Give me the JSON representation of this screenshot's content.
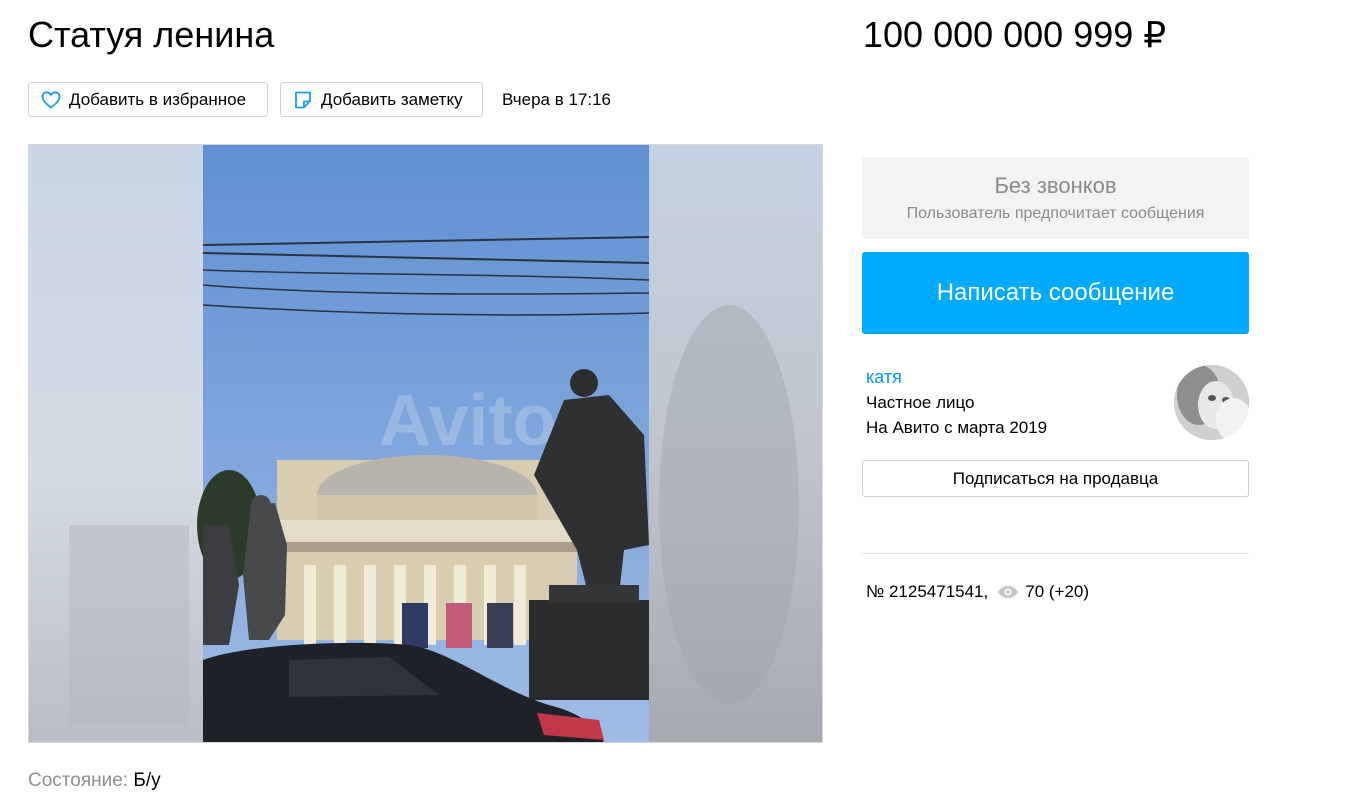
{
  "listing": {
    "title": "Статуя ленина",
    "price": "100 000 000 999 ₽",
    "posted": "Вчера в 17:16",
    "condition_label": "Состояние:",
    "condition_value": "Б/у"
  },
  "actions": {
    "favorite_label": "Добавить в избранное",
    "note_label": "Добавить заметку"
  },
  "contact": {
    "no_calls_title": "Без звонков",
    "no_calls_subtitle": "Пользователь предпочитает сообщения",
    "message_button": "Написать сообщение"
  },
  "seller": {
    "name": "катя",
    "type": "Частное лицо",
    "since": "На Авито с марта 2019",
    "subscribe_label": "Подписаться на продавца"
  },
  "stats": {
    "id_text": "№ 2125471541,",
    "views_text": "70 (+20)"
  },
  "gallery": {
    "watermark": "Avito"
  },
  "colors": {
    "accent": "#00aaff",
    "seller_link": "#0099f7",
    "muted": "#8f8f8f"
  }
}
